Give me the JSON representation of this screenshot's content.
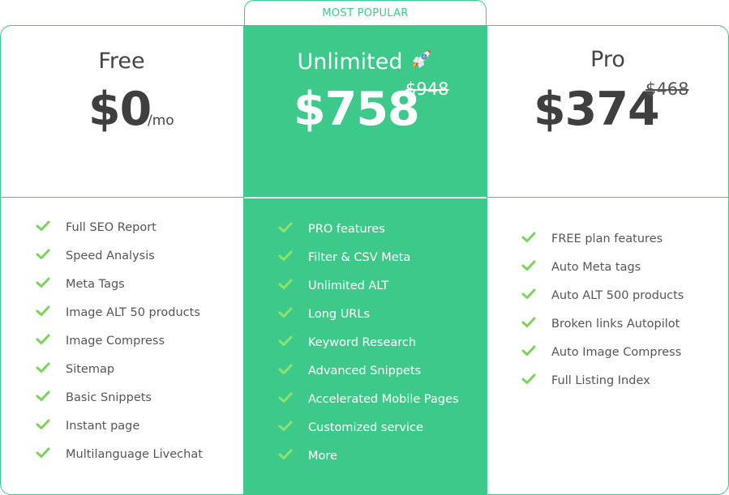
{
  "badge": "MOST POPULAR",
  "plans": {
    "free": {
      "name": "Free",
      "price": "$0",
      "per": "/mo",
      "features": [
        "Full SEO Report",
        "Speed Analysis",
        "Meta Tags",
        "Image ALT 50 products",
        "Image Compress",
        "Sitemap",
        "Basic Snippets",
        "Instant page",
        "Multilanguage Livechat"
      ]
    },
    "unlimited": {
      "name": "Unlimited",
      "icon": "rocket-icon",
      "price": "$758",
      "old_price": "$948",
      "features": [
        "PRO features",
        "Filter & CSV Meta",
        "Unlimited ALT",
        "Long URLs",
        "Keyword Research",
        "Advanced Snippets",
        "Accelerated Mobile Pages",
        "Customized service",
        "More"
      ]
    },
    "pro": {
      "name": "Pro",
      "price": "$374",
      "old_price": "$468",
      "features": [
        "FREE plan features",
        "Auto Meta tags",
        "Auto ALT 500 products",
        "Broken links Autopilot",
        "Auto Image Compress",
        "Full Listing Index"
      ]
    }
  },
  "colors": {
    "accent": "#3cc98a",
    "check": "#7bd35a",
    "text": "#4a4a4a"
  }
}
